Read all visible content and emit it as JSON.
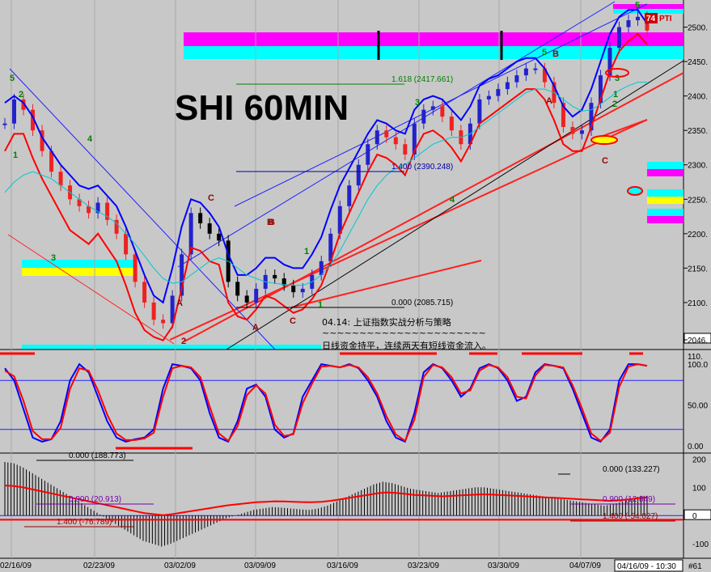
{
  "chart_data": [
    {
      "type": "line",
      "panel": "price",
      "title": "SHI 60MIN",
      "y_ticks": [
        "2500.",
        "2450.",
        "2400.",
        "2350.",
        "2300.",
        "2250.",
        "2200.",
        "2150.",
        "2100.",
        "2046."
      ],
      "ylim": [
        2040,
        2530
      ],
      "price_tag": "74",
      "price_tag_suffix": "PTI",
      "series": [
        {
          "name": "",
          "role": "close",
          "color": "#2222cc",
          "values": [
            2360,
            2395,
            2380,
            2350,
            2320,
            2290,
            2270,
            2250,
            2240,
            2230,
            2245,
            2220,
            2200,
            2170,
            2130,
            2100,
            2075,
            2070,
            2110,
            2170,
            2230,
            2215,
            2200,
            2190,
            2130,
            2110,
            2100,
            2120,
            2140,
            2135,
            2125,
            2115,
            2120,
            2140,
            2160,
            2200,
            2240,
            2270,
            2300,
            2330,
            2350,
            2340,
            2330,
            2315,
            2360,
            2380,
            2385,
            2370,
            2350,
            2330,
            2360,
            2395,
            2400,
            2410,
            2420,
            2430,
            2440,
            2440,
            2420,
            2390,
            2355,
            2345,
            2350,
            2390,
            2430,
            2470,
            2500,
            2510,
            2515,
            2495
          ]
        },
        {
          "name": "",
          "role": "upper band",
          "color": "#0000ff",
          "values": [
            2390,
            2400,
            2390,
            2370,
            2340,
            2320,
            2300,
            2285,
            2270,
            2265,
            2270,
            2255,
            2240,
            2210,
            2175,
            2140,
            2110,
            2100,
            2150,
            2210,
            2250,
            2245,
            2230,
            2210,
            2170,
            2140,
            2140,
            2150,
            2165,
            2165,
            2155,
            2150,
            2150,
            2170,
            2195,
            2235,
            2270,
            2295,
            2320,
            2345,
            2365,
            2360,
            2350,
            2345,
            2380,
            2395,
            2400,
            2395,
            2380,
            2365,
            2385,
            2415,
            2425,
            2430,
            2440,
            2450,
            2455,
            2455,
            2440,
            2415,
            2385,
            2370,
            2380,
            2410,
            2450,
            2490,
            2515,
            2525,
            2525,
            2505
          ]
        },
        {
          "name": "",
          "role": "lower band",
          "color": "#ff0000",
          "values": [
            2320,
            2345,
            2345,
            2310,
            2280,
            2255,
            2230,
            2205,
            2195,
            2185,
            2200,
            2180,
            2160,
            2125,
            2085,
            2060,
            2050,
            2045,
            2065,
            2120,
            2180,
            2175,
            2160,
            2155,
            2100,
            2080,
            2075,
            2090,
            2110,
            2105,
            2095,
            2085,
            2090,
            2105,
            2125,
            2160,
            2200,
            2230,
            2260,
            2290,
            2315,
            2310,
            2300,
            2285,
            2320,
            2345,
            2350,
            2340,
            2325,
            2305,
            2330,
            2360,
            2370,
            2380,
            2390,
            2400,
            2410,
            2410,
            2395,
            2365,
            2330,
            2320,
            2320,
            2355,
            2395,
            2435,
            2465,
            2480,
            2490,
            2475
          ]
        },
        {
          "name": "",
          "role": "moving average",
          "color": "#00c8d0",
          "values": [
            2260,
            2275,
            2285,
            2290,
            2285,
            2280,
            2270,
            2260,
            2250,
            2240,
            2232,
            2225,
            2215,
            2200,
            2185,
            2168,
            2150,
            2135,
            2128,
            2130,
            2140,
            2150,
            2160,
            2165,
            2160,
            2150,
            2140,
            2135,
            2130,
            2128,
            2126,
            2125,
            2125,
            2130,
            2140,
            2155,
            2175,
            2200,
            2225,
            2250,
            2270,
            2285,
            2295,
            2300,
            2310,
            2320,
            2330,
            2335,
            2340,
            2340,
            2345,
            2355,
            2365,
            2375,
            2385,
            2395,
            2405,
            2410,
            2410,
            2405,
            2395,
            2385,
            2378,
            2380,
            2388,
            2398,
            2408,
            2415,
            2420,
            2420
          ]
        }
      ],
      "fib_levels": [
        {
          "label": "1.618 (2417.661)",
          "value": 2417.661
        },
        {
          "label": "1.400 (2390.248)",
          "value": 2290.248
        },
        {
          "label": "0.000 (2085.715)",
          "value": 2085.715
        }
      ],
      "wave_labels": [
        "5",
        "2",
        "1",
        "4",
        "3",
        "C",
        "B",
        "A",
        "C",
        "1",
        "2",
        "3",
        "5",
        "B",
        "A",
        "4",
        "C",
        "3",
        "5",
        "2",
        "1",
        "1",
        "A",
        "B"
      ],
      "annotations": [
        "04.14: 上证指数实战分析与策略",
        "~~~~~~~~~~~~~~~~~~~~~~",
        "日线资金持平，连续两天有短线资金流入。"
      ]
    },
    {
      "type": "line",
      "panel": "stochastic",
      "y_ticks": [
        "110.",
        "100.0",
        "50.00",
        "0.00"
      ],
      "ylim": [
        -5,
        112
      ],
      "series": [
        {
          "name": "",
          "role": "%K",
          "color": "#0000ff",
          "values": [
            95,
            80,
            45,
            10,
            5,
            8,
            30,
            80,
            100,
            90,
            60,
            30,
            10,
            5,
            8,
            10,
            20,
            70,
            100,
            98,
            95,
            80,
            40,
            10,
            5,
            30,
            70,
            75,
            60,
            20,
            10,
            15,
            60,
            80,
            100,
            98,
            96,
            100,
            95,
            80,
            60,
            30,
            10,
            5,
            40,
            90,
            100,
            95,
            80,
            60,
            70,
            95,
            100,
            95,
            80,
            55,
            60,
            90,
            100,
            98,
            95,
            70,
            40,
            10,
            5,
            20,
            80,
            100,
            100,
            98
          ]
        },
        {
          "name": "",
          "role": "%D",
          "color": "#ff0000",
          "values": [
            92,
            85,
            55,
            18,
            8,
            8,
            22,
            70,
            95,
            92,
            68,
            38,
            15,
            7,
            7,
            9,
            16,
            60,
            95,
            98,
            96,
            84,
            48,
            15,
            6,
            24,
            62,
            74,
            64,
            26,
            12,
            14,
            52,
            76,
            97,
            98,
            96,
            99,
            96,
            84,
            64,
            36,
            14,
            6,
            32,
            84,
            99,
            96,
            84,
            64,
            68,
            92,
            99,
            96,
            84,
            60,
            58,
            86,
            99,
            98,
            96,
            74,
            46,
            15,
            6,
            16,
            72,
            97,
            100,
            98
          ]
        }
      ]
    },
    {
      "type": "bar",
      "panel": "oscillator",
      "y_ticks": [
        "200",
        "100",
        "0",
        "-100"
      ],
      "ylim": [
        -140,
        210
      ],
      "levels": [
        {
          "label": "0.000 (133.227)",
          "value": 133.227
        },
        {
          "label": "0.900 (20.913)",
          "value": 20.913
        },
        {
          "label": "1.400 (-76.789)",
          "value": -76.789
        },
        {
          "label": "0.900 (12.849)",
          "value": 12.849
        },
        {
          "label": "1.400 (-54.027)",
          "value": -54.027
        },
        {
          "label": "0.000 (188.773)",
          "value": 188.773
        }
      ],
      "values": [
        190,
        185,
        170,
        150,
        130,
        110,
        90,
        70,
        50,
        30,
        10,
        -10,
        -30,
        -50,
        -70,
        -90,
        -100,
        -110,
        -100,
        -85,
        -70,
        -55,
        -40,
        -25,
        -10,
        0,
        10,
        20,
        25,
        30,
        28,
        25,
        22,
        20,
        25,
        35,
        50,
        65,
        80,
        95,
        110,
        120,
        115,
        105,
        95,
        90,
        85,
        80,
        85,
        90,
        95,
        100,
        100,
        95,
        90,
        85,
        80,
        75,
        70,
        65,
        60,
        55,
        50,
        45,
        40,
        35,
        40,
        50,
        60,
        70
      ]
    }
  ],
  "x_axis": {
    "labels": [
      "02/16/09",
      "02/23/09",
      "03/02/09",
      "03/09/09",
      "03/16/09",
      "03/23/09",
      "03/30/09",
      "04/07/09"
    ],
    "current": "04/16/09 - 10:30",
    "page": "#61"
  },
  "colors": {
    "background": "#c8c8c8",
    "magenta_band": "#ff00ff",
    "cyan_band": "#00ffff",
    "yellow_band": "#ffff00",
    "upper_band": "#0000ff",
    "lower_band": "#ff0000",
    "fib_line": "#008000",
    "wave_green": "#008000",
    "wave_red": "#990000",
    "trend_red": "#ff2020",
    "trend_blue": "#2020ff"
  }
}
